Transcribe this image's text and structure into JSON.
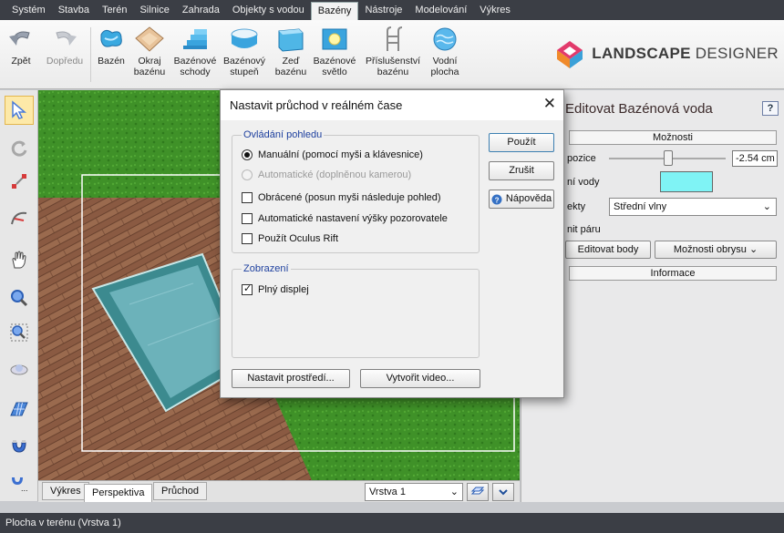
{
  "menu": [
    "Systém",
    "Stavba",
    "Terén",
    "Silnice",
    "Zahrada",
    "Objekty s vodou",
    "Bazény",
    "Nástroje",
    "Modelování",
    "Výkres"
  ],
  "menu_active_index": 6,
  "ribbon": {
    "undo": "Zpět",
    "redo": "Dopředu",
    "pool": "Bazén",
    "pool_edge_1": "Okraj",
    "pool_edge_2": "bazénu",
    "pool_stairs_1": "Bazénové",
    "pool_stairs_2": "schody",
    "pool_step_1": "Bazénový",
    "pool_step_2": "stupeň",
    "pool_wall_1": "Zeď",
    "pool_wall_2": "bazénu",
    "pool_light_1": "Bazénové",
    "pool_light_2": "světlo",
    "accessory_1": "Příslušenství",
    "accessory_2": "bazénu",
    "water_surface_1": "Vodní",
    "water_surface_2": "plocha"
  },
  "logo": {
    "bold": "LANDSCAPE",
    "rest": "DESIGNER"
  },
  "view_tabs": [
    "Výkres",
    "Perspektiva",
    "Průchod"
  ],
  "layer": "Vrstva 1",
  "right_panel": {
    "title": "Editovat Bazénová voda",
    "help": "?",
    "options_header": "Možnosti",
    "position_label": "pozice",
    "position_value": "-2.54 cm",
    "water_color_label": "ní vody",
    "water_color": "#7ff3f5",
    "effects_label": "ekty",
    "effects_value": "Střední vlny",
    "steam_label": "nit páru",
    "edit_points": "Editovat body",
    "outline_options": "Možnosti obrysu",
    "info_header": "Informace"
  },
  "dialog": {
    "title": "Nastavit průchod v reálném čase",
    "close": "✕",
    "group_view": "Ovládání pohledu",
    "manual": "Manuální (pomocí myši a klávesnice)",
    "automatic": "Automatické (doplněnou kamerou)",
    "reverse": "Obrácené (posun myši následuje pohled)",
    "auto_height": "Automatické nastavení výšky pozorovatele",
    "oculus": "Použít Oculus Rift",
    "group_display": "Zobrazení",
    "fullscreen": "Plný displej",
    "apply": "Použít",
    "cancel": "Zrušit",
    "help": "Nápověda",
    "environment": "Nastavit prostředí...",
    "create_video": "Vytvořit video..."
  },
  "status": "Plocha v terénu (Vrstva 1)"
}
